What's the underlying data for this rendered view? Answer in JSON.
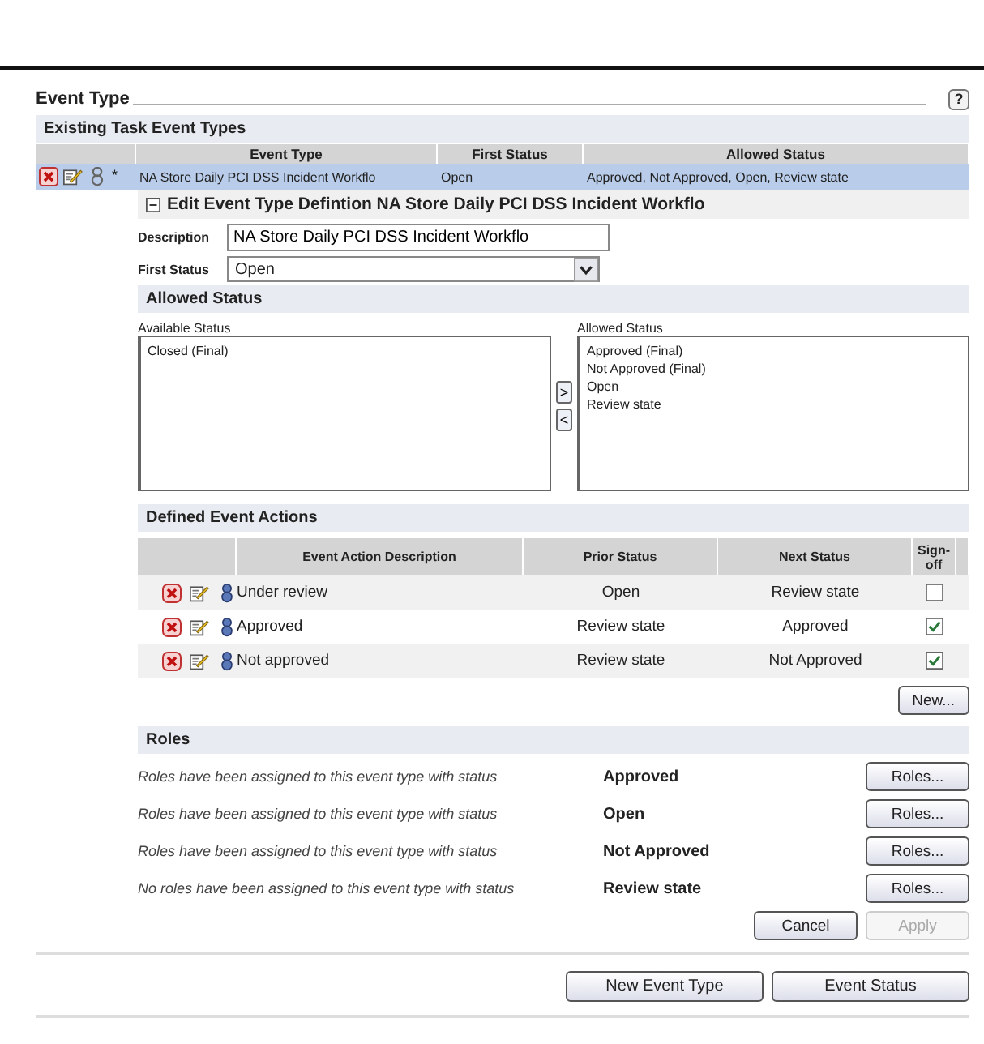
{
  "title": "Event Type",
  "help": "?",
  "existing": {
    "title": "Existing Task Event Types",
    "columns": [
      "Event Type",
      "First Status",
      "Allowed Status"
    ],
    "rows": [
      {
        "marker": "*",
        "event_type": "NA Store Daily PCI DSS Incident Workflo",
        "first_status": "Open",
        "allowed_status": "Approved, Not Approved, Open, Review state",
        "selected": true
      }
    ]
  },
  "edit": {
    "title": "Edit Event Type Defintion NA Store Daily PCI DSS Incident Workflo",
    "expanded": true,
    "description": {
      "label": "Description",
      "value": "NA Store Daily PCI DSS Incident Workflo"
    },
    "first_status": {
      "label": "First Status",
      "value": "Open"
    }
  },
  "allowed": {
    "title": "Allowed Status",
    "available": {
      "label": "Available Status",
      "items": [
        "Closed (Final)"
      ]
    },
    "allowed": {
      "label": "Allowed Status",
      "items": [
        "Approved (Final)",
        "Not Approved (Final)",
        "Open",
        "Review state"
      ]
    },
    "add": ">",
    "remove": "<"
  },
  "actions": {
    "title": "Defined Event Actions",
    "columns": [
      "Event Action Description",
      "Prior Status",
      "Next Status",
      "Sign-off"
    ],
    "rows": [
      {
        "description": "Under review",
        "prior": "Open",
        "next": "Review state",
        "sign_off": false
      },
      {
        "description": "Approved",
        "prior": "Review state",
        "next": "Approved",
        "sign_off": true
      },
      {
        "description": "Not approved",
        "prior": "Review state",
        "next": "Not Approved",
        "sign_off": true
      }
    ],
    "new_button": "New..."
  },
  "roles": {
    "title": "Roles",
    "rows": [
      {
        "text": "Roles have been assigned to this event type with status",
        "status": "Approved",
        "button": "Roles..."
      },
      {
        "text": "Roles have been assigned to this event type with status",
        "status": "Open",
        "button": "Roles..."
      },
      {
        "text": "Roles have been assigned to this event type with status",
        "status": "Not Approved",
        "button": "Roles..."
      },
      {
        "text": "No roles have been assigned to this event type with status",
        "status": "Review state",
        "button": "Roles..."
      }
    ]
  },
  "form_buttons": [
    {
      "label": "Cancel",
      "disabled": false
    },
    {
      "label": "Apply",
      "disabled": true
    }
  ],
  "footer_buttons": [
    {
      "label": "New Event Type",
      "disabled": false
    },
    {
      "label": "Event Status",
      "disabled": false
    }
  ]
}
